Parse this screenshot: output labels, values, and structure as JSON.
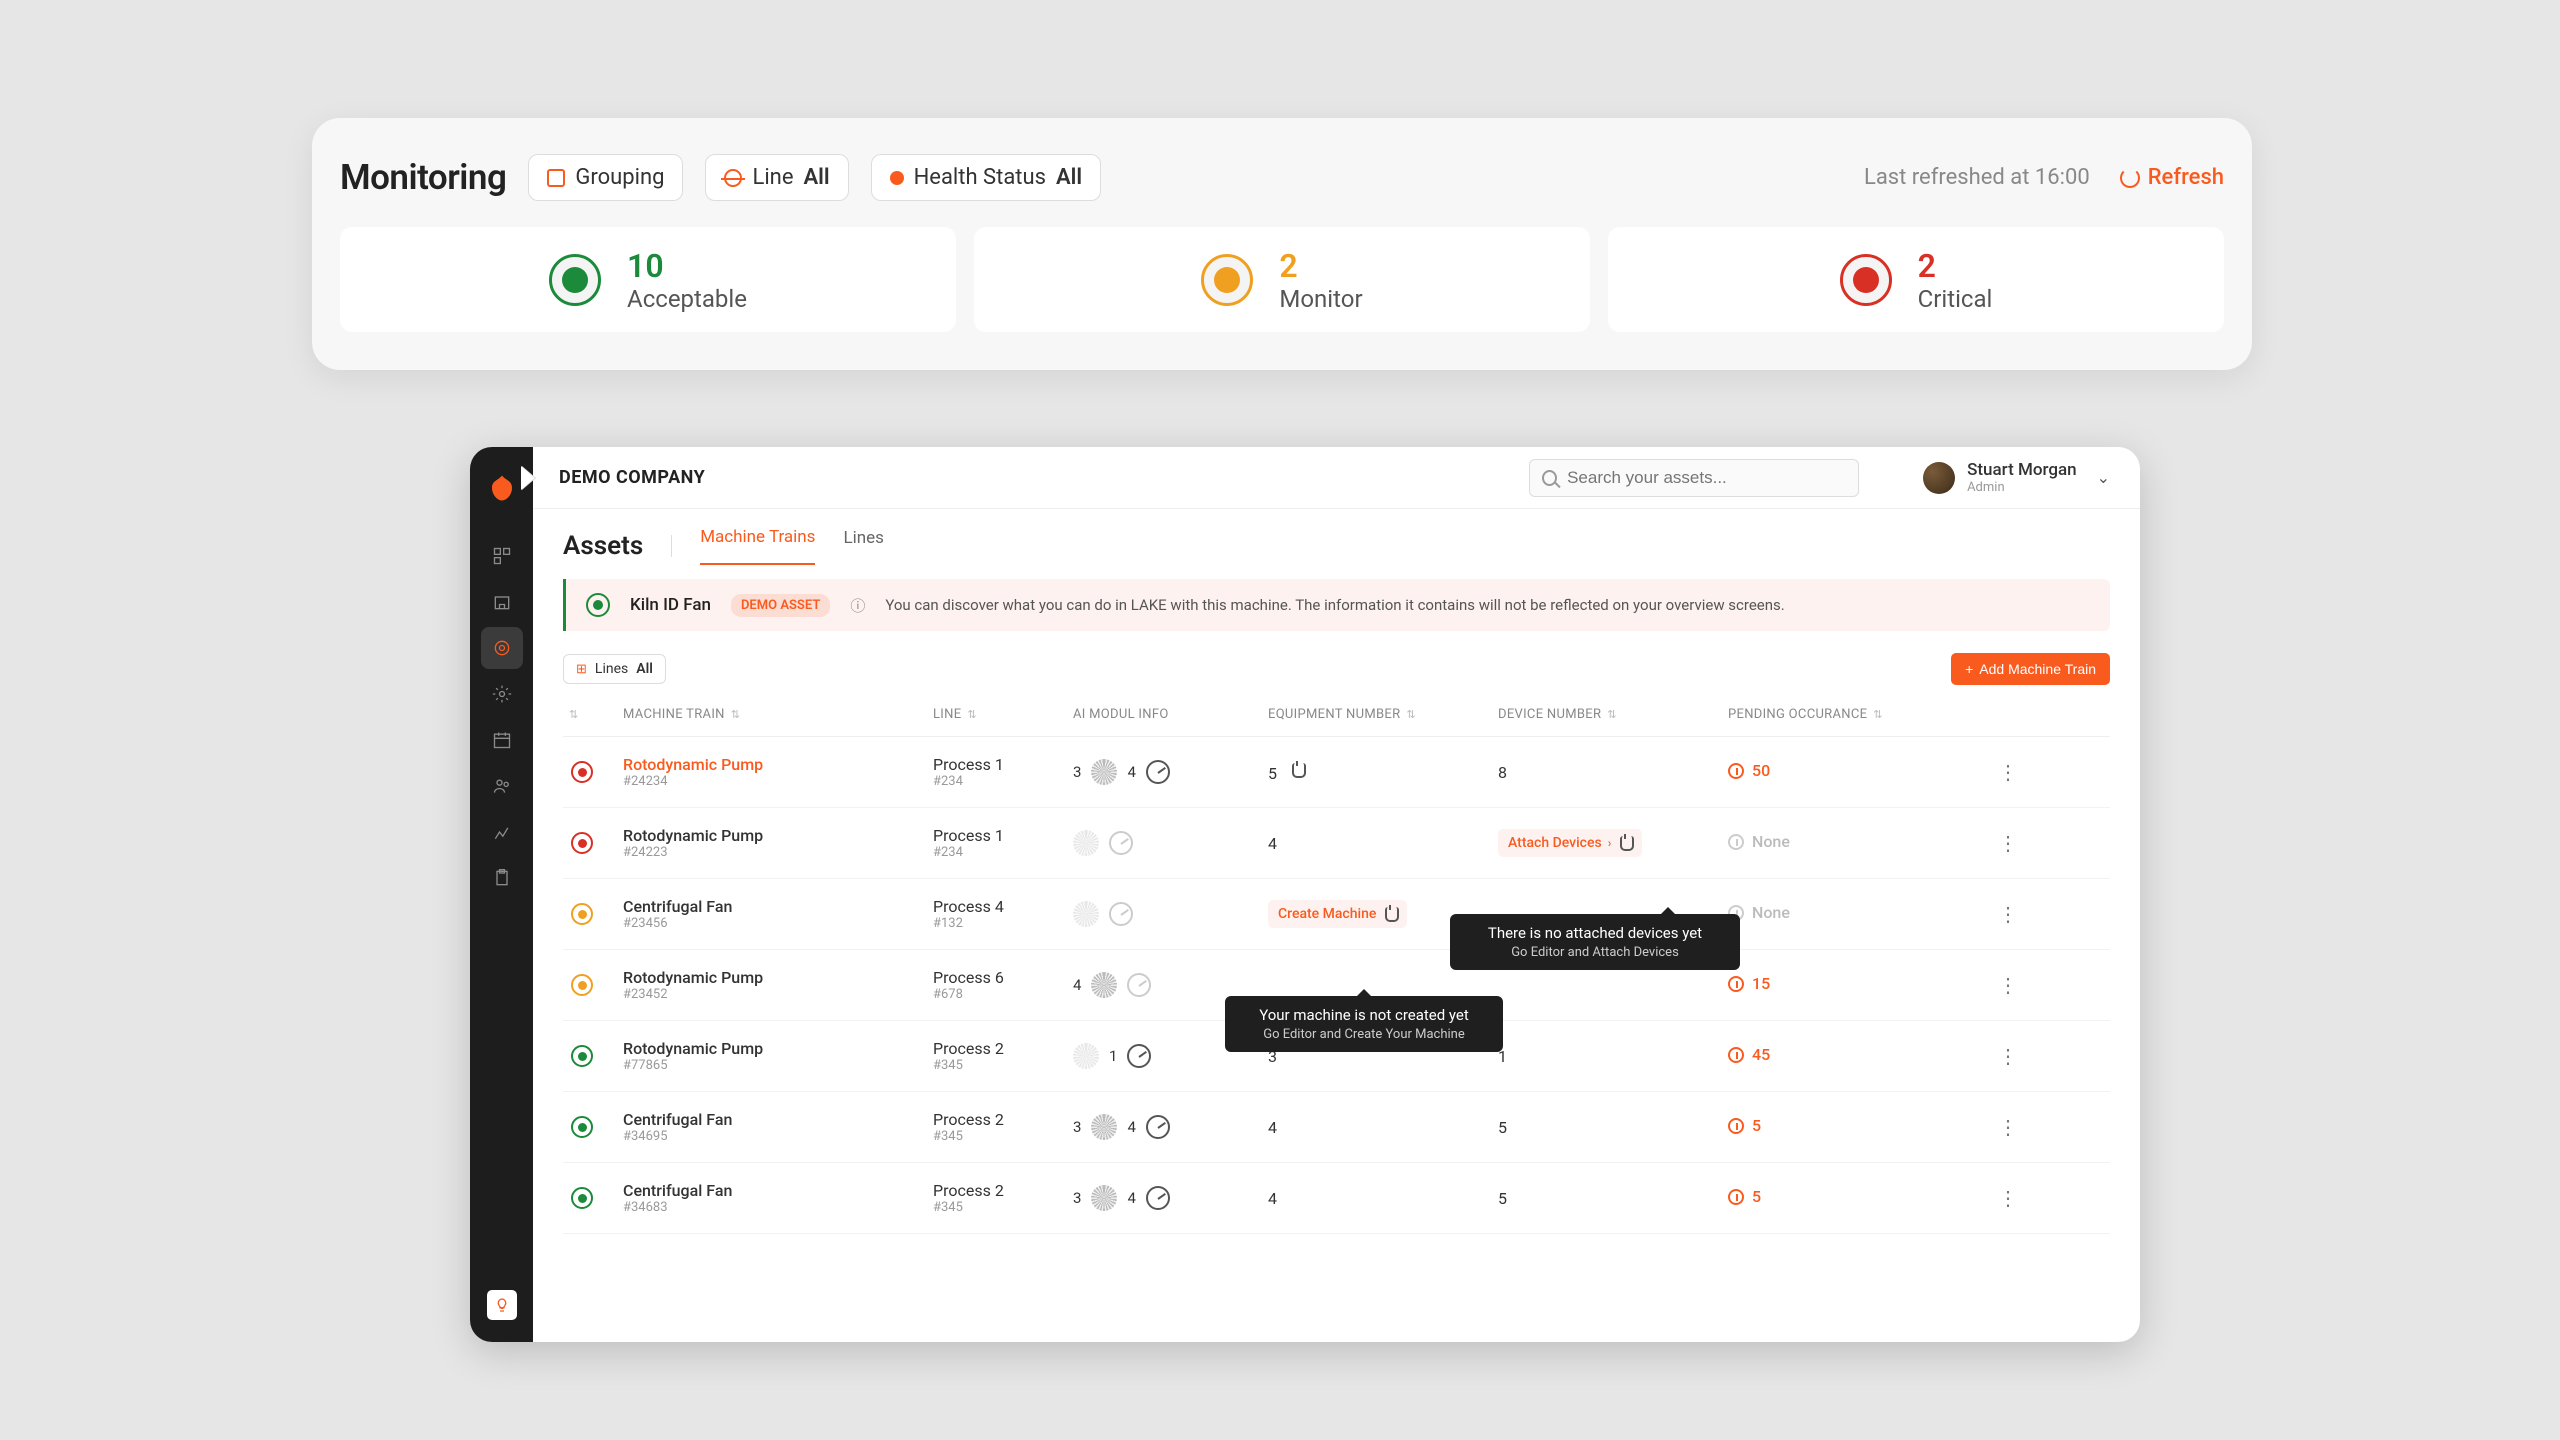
{
  "monitoring": {
    "title": "Monitoring",
    "grouping_label": "Grouping",
    "line_label": "Line",
    "line_value": "All",
    "health_label": "Health Status",
    "health_value": "All",
    "last_refreshed": "Last refreshed at 16:00",
    "refresh": "Refresh",
    "stats": [
      {
        "count": "10",
        "label": "Acceptable",
        "color": "green"
      },
      {
        "count": "2",
        "label": "Monitor",
        "color": "yellow"
      },
      {
        "count": "2",
        "label": "Critical",
        "color": "red"
      }
    ]
  },
  "sidebar": {
    "items": [
      "dashboard",
      "buildings",
      "assets",
      "settings",
      "calendar",
      "users",
      "reports",
      "clipboard"
    ]
  },
  "topbar": {
    "company": "DEMO COMPANY",
    "search_placeholder": "Search your assets...",
    "user_name": "Stuart Morgan",
    "user_role": "Admin"
  },
  "assets": {
    "title": "Assets",
    "tabs": [
      {
        "label": "Machine Trains",
        "active": true
      },
      {
        "label": "Lines",
        "active": false
      }
    ],
    "demo_banner": {
      "name": "Kiln ID Fan",
      "badge": "DEMO ASSET",
      "info": "You can discover what you can do in LAKE with this machine. The information it contains will not be reflected on your overview screens."
    },
    "lines_chip_label": "Lines",
    "lines_chip_value": "All",
    "add_btn": "Add Machine Train",
    "columns": {
      "c1": "MACHINE TRAIN",
      "c2": "LINE",
      "c3": "AI MODUL INFO",
      "c4": "EQUIPMENT NUMBER",
      "c5": "DEVICE NUMBER",
      "c6": "PENDING OCCURANCE"
    },
    "rows": [
      {
        "status": "red",
        "name": "Rotodynamic Pump",
        "id": "#24234",
        "active": true,
        "line": "Process 1",
        "line_id": "#234",
        "ai": {
          "ring": "3",
          "gauge": "4"
        },
        "equipment": "5",
        "device": "8",
        "pending": "50",
        "pending_none": false,
        "equip_cursor": true
      },
      {
        "status": "red",
        "name": "Rotodynamic Pump",
        "id": "#24223",
        "line": "Process 1",
        "line_id": "#234",
        "ai": {
          "dim": true
        },
        "equipment": "4",
        "device_badge": "Attach Devices",
        "pending": "None",
        "pending_none": true
      },
      {
        "status": "yellow",
        "name": "Centrifugal Fan",
        "id": "#23456",
        "line": "Process 4",
        "line_id": "#132",
        "ai": {
          "dim": true
        },
        "equip_badge": "Create Machine",
        "pending": "None",
        "pending_none": true
      },
      {
        "status": "yellow",
        "name": "Rotodynamic Pump",
        "id": "#23452",
        "line": "Process 6",
        "line_id": "#678",
        "ai": {
          "ring": "4",
          "gauge_dim": true
        },
        "equipment": "",
        "device": "",
        "pending": "15",
        "pending_none": false
      },
      {
        "status": "green",
        "name": "Rotodynamic Pump",
        "id": "#77865",
        "line": "Process 2",
        "line_id": "#345",
        "ai": {
          "ring_dim": true,
          "gauge": "1"
        },
        "equipment": "3",
        "device": "1",
        "pending": "45",
        "pending_none": false
      },
      {
        "status": "green",
        "name": "Centrifugal Fan",
        "id": "#34695",
        "line": "Process 2",
        "line_id": "#345",
        "ai": {
          "ring": "3",
          "gauge": "4"
        },
        "equipment": "4",
        "device": "5",
        "pending": "5",
        "pending_none": false
      },
      {
        "status": "green",
        "name": "Centrifugal Fan",
        "id": "#34683",
        "line": "Process 2",
        "line_id": "#345",
        "ai": {
          "ring": "3",
          "gauge": "4"
        },
        "equipment": "4",
        "device": "5",
        "pending": "5",
        "pending_none": false
      }
    ]
  },
  "tooltips": {
    "create": {
      "title": "Your machine is not created yet",
      "sub": "Go Editor and Create Your Machine"
    },
    "attach": {
      "title": "There is no attached devices yet",
      "sub": "Go Editor and Attach Devices"
    }
  }
}
